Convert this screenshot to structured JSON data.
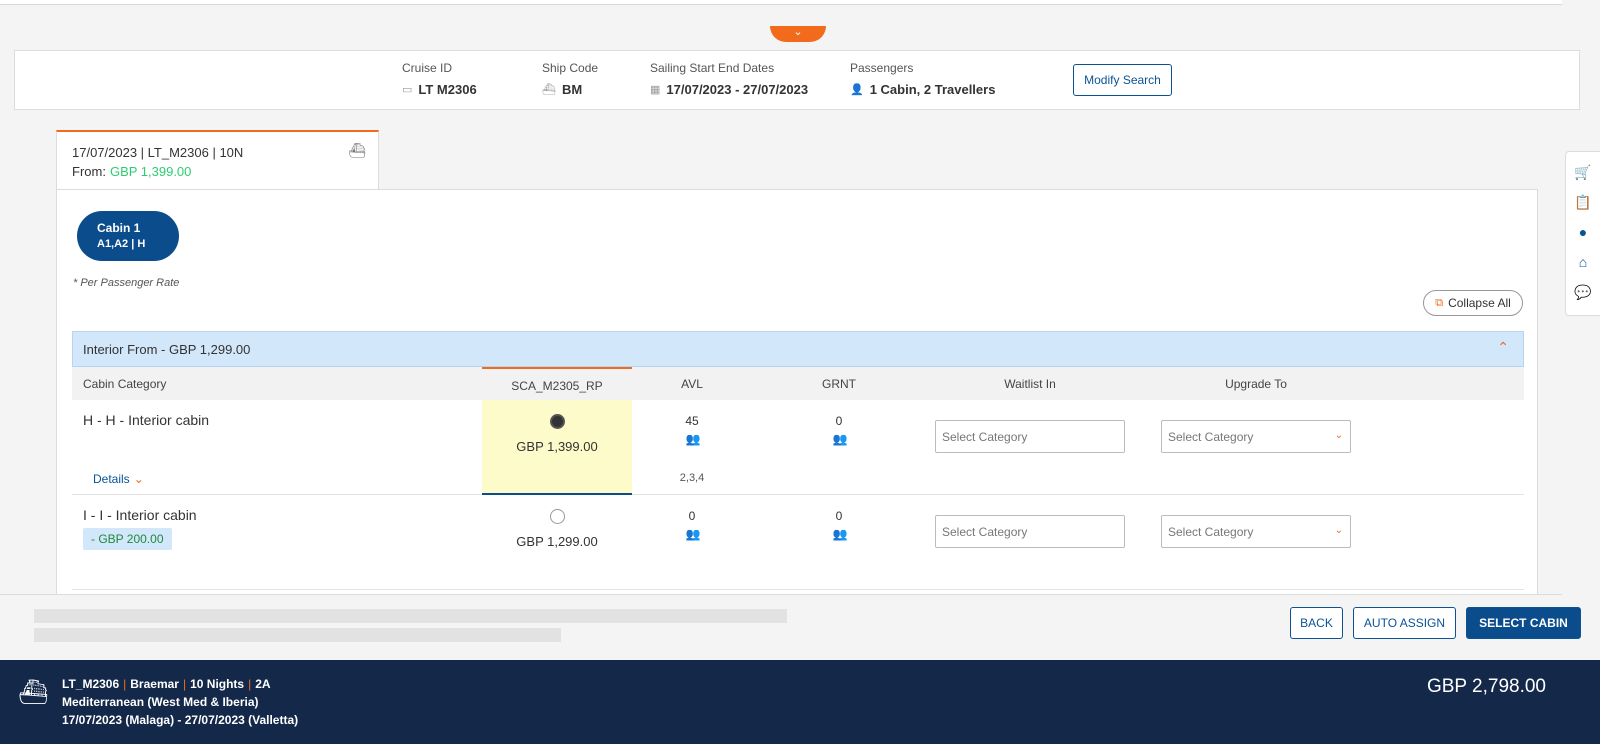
{
  "search": {
    "cruise_id_label": "Cruise ID",
    "cruise_id": "LT  M2306",
    "ship_code_label": "Ship Code",
    "ship_code": "BM",
    "dates_label": "Sailing Start End Dates",
    "dates": "17/07/2023 - 27/07/2023",
    "passengers_label": "Passengers",
    "passengers": "1 Cabin, 2 Travellers",
    "modify_label": "Modify Search"
  },
  "tab": {
    "summary": "17/07/2023 | LT_M2306 | 10N",
    "from_label": "From:",
    "from_price": "GBP 1,399.00"
  },
  "cabin_pill": {
    "title": "Cabin 1",
    "sub": "A1,A2  |  H"
  },
  "per_passenger_note": "* Per Passenger Rate",
  "collapse_all": "Collapse All",
  "category": {
    "header": "Interior From - GBP 1,299.00",
    "columns": {
      "cabin_category": "Cabin Category",
      "fare": "SCA_M2305_RP",
      "avl": "AVL",
      "grnt": "GRNT",
      "waitlist": "Waitlist In",
      "upgrade": "Upgrade To"
    },
    "rows": [
      {
        "name": "H - H - Interior cabin",
        "details": "Details",
        "price": "GBP 1,399.00",
        "avl": "45",
        "grnt": "0",
        "occupancy": "2,3,4",
        "waitlist_placeholder": "Select Category",
        "upgrade_placeholder": "Select Category"
      },
      {
        "name": "I - I - Interior cabin",
        "discount": "- GBP 200.00",
        "price": "GBP 1,299.00",
        "avl": "0",
        "grnt": "0",
        "waitlist_placeholder": "Select Category",
        "upgrade_placeholder": "Select Category"
      }
    ]
  },
  "actions": {
    "back": "BACK",
    "auto_assign": "AUTO ASSIGN",
    "select_cabin": "SELECT CABIN"
  },
  "footer": {
    "code": "LT_M2306",
    "ship": "Braemar",
    "nights": "10 Nights",
    "occupancy": "2A",
    "region": "Mediterranean (West Med & Iberia)",
    "route": "17/07/2023 (Malaga) - 27/07/2023 (Valletta)",
    "total": "GBP 2,798.00"
  },
  "icons": {
    "collapse": "chevron-down-icon",
    "rail": [
      "cart-icon",
      "clipboard-icon",
      "user-icon",
      "home-icon",
      "chat-icon"
    ]
  },
  "colors": {
    "accent": "#f26b1d",
    "primary": "#0b4c8c",
    "footer": "#14294a",
    "price_green": "#2ecc71"
  }
}
